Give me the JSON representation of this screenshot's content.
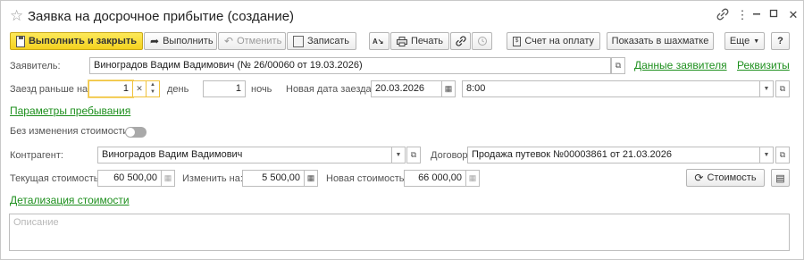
{
  "window": {
    "title": "Заявка на досрочное прибытие (создание)"
  },
  "toolbar": {
    "execute_close": "Выполнить и закрыть",
    "execute": "Выполнить",
    "cancel": "Отменить",
    "save": "Записать",
    "print": "Печать",
    "invoice": "Счет на оплату",
    "chessboard": "Показать в шахматке",
    "more": "Еще",
    "help": "?"
  },
  "applicant": {
    "label": "Заявитель:",
    "value": "Виноградов Вадим Вадимович (№ 26/00060 от 19.03.2026)",
    "link_data": "Данные заявителя",
    "link_details": "Реквизиты"
  },
  "arrival": {
    "label": "Заезд раньше на:",
    "days_value": "1",
    "days_unit": "день",
    "nights_value": "1",
    "nights_unit": "ночь",
    "new_date_label": "Новая дата заезда:",
    "new_date": "20.03.2026",
    "new_time": "8:00"
  },
  "stay_params_link": "Параметры пребывания",
  "no_cost_change": {
    "label": "Без изменения стоимости:"
  },
  "counterparty": {
    "label": "Контрагент:",
    "value": "Виноградов Вадим Вадимович"
  },
  "contract": {
    "label": "Договор:",
    "value": "Продажа путевок №00003861 от 21.03.2026"
  },
  "cost": {
    "current_label": "Текущая стоимость:",
    "current_value": "60 500,00",
    "change_label": "Изменить на:",
    "change_value": "5 500,00",
    "new_label": "Новая стоимость:",
    "new_value": "66 000,00",
    "button": "Стоимость"
  },
  "cost_details_link": "Детализация стоимости",
  "description": {
    "placeholder": "Описание"
  }
}
